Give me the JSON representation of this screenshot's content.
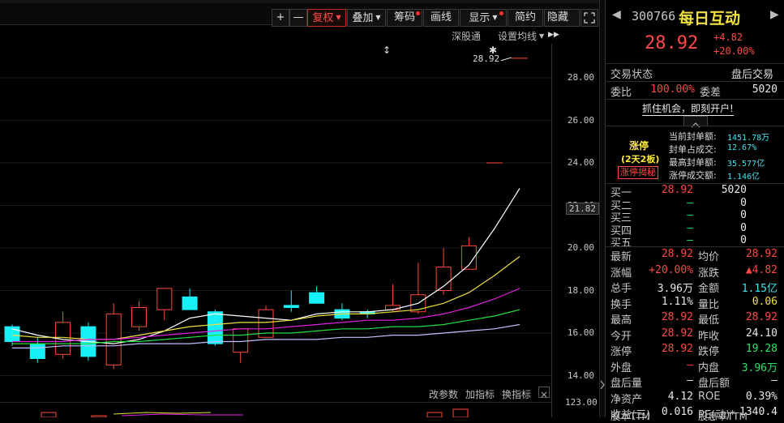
{
  "toolbar": {
    "zoom_in": "+",
    "zoom_out": "—",
    "adjust": "复权",
    "overlay": "叠加",
    "chips": "筹码",
    "draw": "画线",
    "display": "显示",
    "simple": "简约",
    "hide": "隐藏",
    "more": "▶▶",
    "expand_icon": "expand-icon"
  },
  "subbar": {
    "shenguton": "深股通",
    "ma_settings": "设置均线"
  },
  "chart": {
    "last_price_label": "28.92",
    "cursor_price": "21.82",
    "y_ticks": [
      "28.00",
      "26.00",
      "24.00",
      "22.00",
      "20.00",
      "18.00",
      "16.00",
      "14.00"
    ],
    "bottom_tick": "123.00",
    "y_range": [
      13.6,
      29.6
    ],
    "candles": [
      {
        "o": 16.3,
        "h": 16.4,
        "l": 15.4,
        "c": 15.6,
        "up": false
      },
      {
        "o": 15.5,
        "h": 15.8,
        "l": 14.6,
        "c": 14.8,
        "up": false
      },
      {
        "o": 15.0,
        "h": 17.0,
        "l": 14.8,
        "c": 16.5,
        "up": true
      },
      {
        "o": 16.3,
        "h": 16.5,
        "l": 14.7,
        "c": 14.9,
        "up": false
      },
      {
        "o": 14.5,
        "h": 17.4,
        "l": 14.3,
        "c": 16.9,
        "up": true
      },
      {
        "o": 16.3,
        "h": 17.5,
        "l": 16.1,
        "c": 17.2,
        "up": true
      },
      {
        "o": 17.1,
        "h": 18.1,
        "l": 16.6,
        "c": 18.1,
        "up": true
      },
      {
        "o": 17.7,
        "h": 18.1,
        "l": 17.1,
        "c": 17.1,
        "up": false
      },
      {
        "o": 17.0,
        "h": 17.1,
        "l": 15.4,
        "c": 15.5,
        "up": false
      },
      {
        "o": 15.1,
        "h": 16.2,
        "l": 14.6,
        "c": 16.2,
        "up": true
      },
      {
        "o": 15.8,
        "h": 17.3,
        "l": 15.8,
        "c": 17.1,
        "up": true
      },
      {
        "o": 17.2,
        "h": 18.0,
        "l": 17.0,
        "c": 17.3,
        "up": false
      },
      {
        "o": 17.9,
        "h": 18.2,
        "l": 17.4,
        "c": 17.4,
        "up": false
      },
      {
        "o": 17.1,
        "h": 17.4,
        "l": 16.6,
        "c": 16.7,
        "up": false
      },
      {
        "o": 16.9,
        "h": 17.1,
        "l": 16.7,
        "c": 17.0,
        "up": false
      },
      {
        "o": 17.1,
        "h": 18.3,
        "l": 17.0,
        "c": 17.3,
        "up": true
      },
      {
        "o": 17.0,
        "h": 19.3,
        "l": 16.9,
        "c": 17.8,
        "up": true
      },
      {
        "o": 18.0,
        "h": 20.0,
        "l": 17.8,
        "c": 19.1,
        "up": true
      },
      {
        "o": 19.0,
        "h": 20.5,
        "l": 19.0,
        "c": 20.1,
        "up": true
      },
      {
        "o": 24.0,
        "h": 24.0,
        "l": 24.0,
        "c": 24.0,
        "up": true
      },
      {
        "o": 28.92,
        "h": 28.92,
        "l": 28.92,
        "c": 28.92,
        "up": true
      }
    ],
    "ma": [
      {
        "color": "#ffffff",
        "values": [
          16.2,
          15.9,
          15.7,
          15.6,
          15.5,
          15.7,
          16.1,
          16.7,
          16.9,
          16.8,
          16.7,
          16.6,
          16.9,
          17.0,
          17.0,
          17.1,
          17.4,
          18.2,
          19.2,
          20.9,
          22.8
        ]
      },
      {
        "color": "#f0e040",
        "values": [
          15.9,
          15.8,
          15.8,
          15.7,
          15.7,
          15.9,
          16.1,
          16.3,
          16.4,
          16.5,
          16.5,
          16.6,
          16.8,
          16.9,
          16.9,
          17.0,
          17.1,
          17.4,
          17.9,
          18.7,
          19.6
        ]
      },
      {
        "color": "#e020e0",
        "values": [
          15.6,
          15.6,
          15.6,
          15.7,
          15.7,
          15.8,
          15.9,
          16.0,
          16.1,
          16.2,
          16.2,
          16.3,
          16.4,
          16.5,
          16.6,
          16.6,
          16.7,
          16.9,
          17.2,
          17.6,
          18.1
        ]
      },
      {
        "color": "#20e040",
        "values": [
          15.5,
          15.5,
          15.5,
          15.5,
          15.6,
          15.6,
          15.7,
          15.8,
          15.9,
          15.9,
          16.0,
          16.0,
          16.1,
          16.2,
          16.2,
          16.3,
          16.3,
          16.4,
          16.6,
          16.8,
          17.1
        ]
      },
      {
        "color": "#c0c0ff",
        "values": [
          15.3,
          15.3,
          15.4,
          15.4,
          15.4,
          15.5,
          15.5,
          15.5,
          15.6,
          15.6,
          15.7,
          15.7,
          15.7,
          15.8,
          15.8,
          15.9,
          15.9,
          16.0,
          16.1,
          16.2,
          16.4
        ]
      }
    ]
  },
  "indicator_bar": {
    "change_params": "改参数",
    "add_indicator": "加指标",
    "switch_indicator": "换指标",
    "close_icon": "close-icon"
  },
  "quote": {
    "code": "300766",
    "name": "每日互动",
    "price": "28.92",
    "change": "+4.82",
    "change_pct": "+20.00%",
    "status_label": "交易状态",
    "status_value": "盘后交易",
    "wb_label": "委比",
    "wb_value": "100.00%",
    "wc_label": "委差",
    "wc_value": "5020",
    "banner": "抓住机会，即刻开户!",
    "limit_title": "涨停",
    "limit_sub": "(2天2板)",
    "limit_btn": "涨停揭秘",
    "limit_info": [
      {
        "label": "当前封单额:",
        "value": "1451.78万"
      },
      {
        "label": "封单占成交:",
        "value": "12.67%"
      },
      {
        "label": "最高封单额:",
        "value": "35.577亿"
      },
      {
        "label": "涨停成交额:",
        "value": "1.146亿"
      }
    ],
    "bids": [
      {
        "label": "买一",
        "price": "28.92",
        "vol": "5020"
      },
      {
        "label": "买二",
        "price": "—",
        "vol": "0"
      },
      {
        "label": "买三",
        "price": "—",
        "vol": "0"
      },
      {
        "label": "买四",
        "price": "—",
        "vol": "0"
      },
      {
        "label": "买五",
        "price": "—",
        "vol": "0"
      }
    ],
    "stats": [
      {
        "l1": "最新",
        "v1": "28.92",
        "c1": "red",
        "l2": "均价",
        "v2": "28.92",
        "c2": "red"
      },
      {
        "l1": "涨幅",
        "v1": "+20.00%",
        "c1": "red",
        "l2": "涨跌",
        "v2": "▲4.82",
        "c2": "red"
      },
      {
        "l1": "总手",
        "v1": "3.96万",
        "c1": "white",
        "l2": "金额",
        "v2": "1.15亿",
        "c2": "cyan"
      },
      {
        "l1": "换手",
        "v1": "1.11%",
        "c1": "white",
        "l2": "量比",
        "v2": "0.06",
        "c2": "yellow"
      },
      {
        "l1": "最高",
        "v1": "28.92",
        "c1": "red",
        "l2": "最低",
        "v2": "28.92",
        "c2": "red"
      },
      {
        "l1": "今开",
        "v1": "28.92",
        "c1": "red",
        "l2": "昨收",
        "v2": "24.10",
        "c2": "white"
      },
      {
        "l1": "涨停",
        "v1": "28.92",
        "c1": "red",
        "l2": "跌停",
        "v2": "19.28",
        "c2": "green"
      },
      {
        "l1": "外盘",
        "v1": "—",
        "c1": "red",
        "l2": "内盘",
        "v2": "3.96万",
        "c2": "green"
      },
      {
        "l1": "盘后量",
        "v1": "—",
        "c1": "white",
        "l2": "盘后额",
        "v2": "—",
        "c2": "white"
      },
      {
        "l1": "净资产",
        "v1": "4.12",
        "c1": "white",
        "l2": "ROE",
        "v2": "0.39%",
        "c2": "white"
      },
      {
        "l1": "收益(三)",
        "v1": "0.016",
        "c1": "white",
        "l2": "PE(动)*",
        "v2": "1340.4",
        "c2": "white"
      }
    ],
    "bottom_partial_1": "股本TTM",
    "bottom_partial_2": "股息率TTM"
  }
}
